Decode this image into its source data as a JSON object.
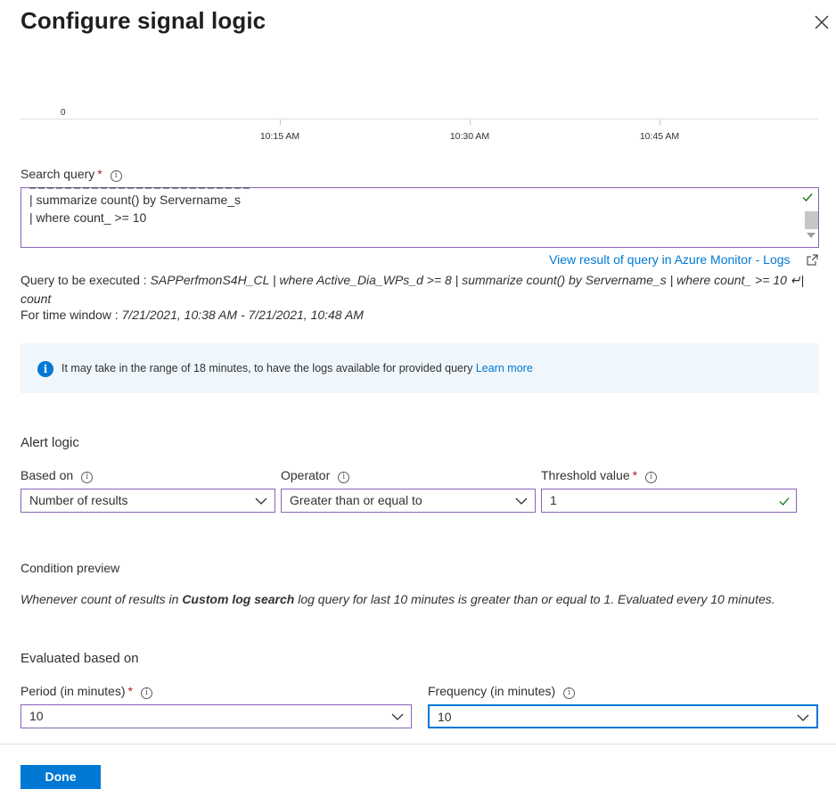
{
  "header": {
    "title": "Configure signal logic",
    "close_icon": "close-icon"
  },
  "chart": {
    "y_zero": "0",
    "x_ticks": [
      "10:15 AM",
      "10:30 AM",
      "10:45 AM"
    ]
  },
  "search": {
    "label": "Search query",
    "required_marker": "*",
    "query_lines": [
      "| summarize count() by Servername_s",
      "| where count_ >= 10"
    ],
    "view_link": "View result of query in Azure Monitor - Logs"
  },
  "execution": {
    "prefix": "Query to be executed : ",
    "query": "SAPPerfmonS4H_CL | where Active_Dia_WPs_d >= 8 | summarize count() by Servername_s | where count_ >= 10 ↵| count",
    "time_prefix": "For time window : ",
    "time_window": "7/21/2021, 10:38 AM - 7/21/2021, 10:48 AM"
  },
  "banner": {
    "text": "It may take in the range of 18 minutes, to have the logs available for provided query ",
    "link": "Learn more"
  },
  "alert_logic": {
    "title": "Alert logic",
    "based_on_label": "Based on",
    "based_on_value": "Number of results",
    "operator_label": "Operator",
    "operator_value": "Greater than or equal to",
    "threshold_label": "Threshold value",
    "threshold_required": "*",
    "threshold_value": "1"
  },
  "condition": {
    "title": "Condition preview",
    "text_before": "Whenever count of results in ",
    "bold": "Custom log search",
    "text_after": " log query for last 10 minutes is greater than or equal to 1. Evaluated every 10 minutes."
  },
  "evaluation": {
    "title": "Evaluated based on",
    "period_label": "Period (in minutes)",
    "period_required": "*",
    "period_value": "10",
    "frequency_label": "Frequency (in minutes)",
    "frequency_value": "10"
  },
  "footer": {
    "done_label": "Done"
  },
  "colors": {
    "accent": "#0078d4",
    "input_border": "#8764b8",
    "success": "#107c10",
    "required": "#a4262c"
  }
}
